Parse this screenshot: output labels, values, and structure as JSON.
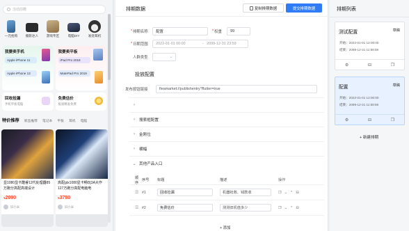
{
  "preview": {
    "search_placeholder": "活动前瞻",
    "categories": [
      {
        "label": "一元抢购",
        "icon": "phone-icon"
      },
      {
        "label": "摄影达人",
        "icon": "camera-icon"
      },
      {
        "label": "游戏专区",
        "icon": "game-icon"
      },
      {
        "label": "电脑DIY",
        "icon": "computer-icon"
      },
      {
        "label": "发烧耳机",
        "icon": "headphone-icon"
      }
    ],
    "card_sell": {
      "title": "我要卖手机",
      "items": [
        "Apple iPhone 11",
        "Apple iPhone 13"
      ]
    },
    "card_pad": {
      "title": "我要卖平板",
      "items": [
        "iPad Pro 2018",
        "MatePad Pro 2019"
      ]
    },
    "promo": [
      {
        "title": "回收捡漏",
        "sub": "手机平板电脑",
        "icon": "recycle-icon"
      },
      {
        "title": "免费估价",
        "sub": "极速精准免费",
        "icon": "coin-icon"
      }
    ],
    "tabs": [
      "特价推荐",
      "新品推荐",
      "笔记本",
      "平板",
      "耳机",
      "电脑"
    ],
    "goods": [
      {
        "name": "显1080显卡酷睿12代处理器85万跑分高配高端设计",
        "price": "2090",
        "seller": "旧小米"
      },
      {
        "name": "高配gtx1080显卡畅玩3A大作127万跑分高配电脑电",
        "price": "3780",
        "seller": "旧小米"
      }
    ]
  },
  "editor": {
    "title": "排期数据",
    "copy_btn": "复制排期数据",
    "save_btn": "提交排期数据",
    "name_label": "排期名称",
    "name_value": "配置",
    "weight_label": "权重",
    "weight_value": "99",
    "date_label": "日期范围",
    "date_start": "2022-01-01 00:00",
    "date_sep": "-",
    "date_end": "2099-12-31 23:59",
    "crowd_label": "人群类型",
    "section_title": "投放配置",
    "link_label": "发布按钮链接",
    "link_value": "fleamarket://publishentry?flutter=true",
    "collapsibles": [
      "",
      "搜索框配置",
      "金刚位",
      "横幅",
      "其他产品入口"
    ],
    "table": {
      "headers": [
        "顺序",
        "序号",
        "标题",
        "描述",
        "操作"
      ],
      "rows": [
        {
          "index": "#1",
          "title": "回收捡漏",
          "desc": "机器抢救、钱款收"
        },
        {
          "index": "#2",
          "title": "免费估价",
          "desc": "测测旧机值多少"
        }
      ]
    },
    "add_label": "+ 添加"
  },
  "list": {
    "title": "排期列表",
    "items": [
      {
        "name": "测试配置",
        "edit": "草稿",
        "start": "开始：2022-01-01 12:00:00",
        "end": "结束：2099-12-31 11:59:59",
        "active": false
      },
      {
        "name": "配置",
        "edit": "草稿",
        "start": "开始：2022-01-01 12:00:00",
        "end": "结束：2099-12-31 11:59:59",
        "active": true
      }
    ],
    "new_label": "+ 新建排期"
  }
}
